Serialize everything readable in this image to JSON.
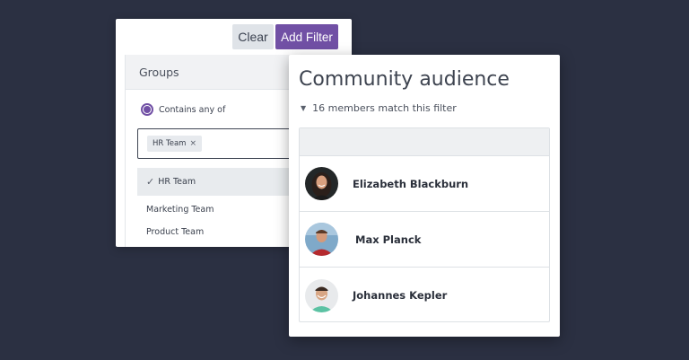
{
  "filter": {
    "clear_label": "Clear",
    "add_filter_label": "Add Filter",
    "groups_header": "Groups",
    "match_mode_label": "Contains any of",
    "selected_tag": "HR Team",
    "tag_remove_glyph": "×",
    "options": [
      {
        "label": "HR Team",
        "selected": true,
        "check": "✓"
      },
      {
        "label": "Marketing Team",
        "selected": false
      },
      {
        "label": "Product Team",
        "selected": false
      }
    ]
  },
  "audience": {
    "title": "Community audience",
    "caret_glyph": "▼",
    "match_text": "16 members match this filter",
    "members": [
      {
        "name": "Elizabeth Blackburn"
      },
      {
        "name": "Max Planck"
      },
      {
        "name": "Johannes Kepler"
      }
    ]
  },
  "colors": {
    "background": "#2b3042",
    "accent": "#7150a5",
    "clear_button": "#dfe3e8"
  },
  "icons": [
    "radio-selected-icon",
    "remove-tag-icon",
    "checkmark-icon",
    "caret-down-icon"
  ]
}
